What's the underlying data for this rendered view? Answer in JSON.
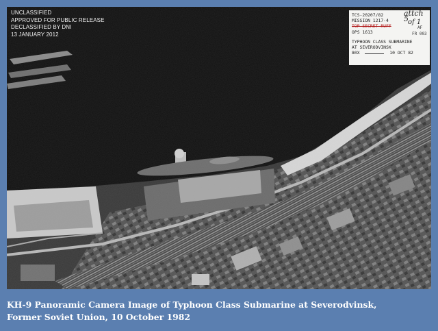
{
  "release_stamp": {
    "lines": [
      "UNCLASSIFIED",
      "APPROVED FOR PUBLIC RELEASE",
      "DECLASSIFIED BY DNI",
      "13 JANUARY 2012"
    ]
  },
  "label_card": {
    "line1": "TCS-20207/82",
    "line2": "MISSION 1217-4",
    "line3": "TOP SECRET RUFF",
    "line4": "OPS 1613",
    "line5": "TYPHOON CLASS SUBMARINE",
    "line6": "AT SEVERODVINSK",
    "line7_left": "80X",
    "line7_right": "10 OCT 82",
    "hand_note": "attch 5",
    "hand_mark": "of 1",
    "side_codes": [
      "AF",
      "FR 003"
    ],
    "strike_color": "#b01818"
  },
  "caption": {
    "line1": "KH-9 Panoramic Camera Image of Typhoon Class Submarine at Severodvinsk,",
    "line2": "Former Soviet Union, 10 October 1982"
  },
  "colors": {
    "background": "#5b7fb0",
    "caption_text": "#ffffff"
  }
}
